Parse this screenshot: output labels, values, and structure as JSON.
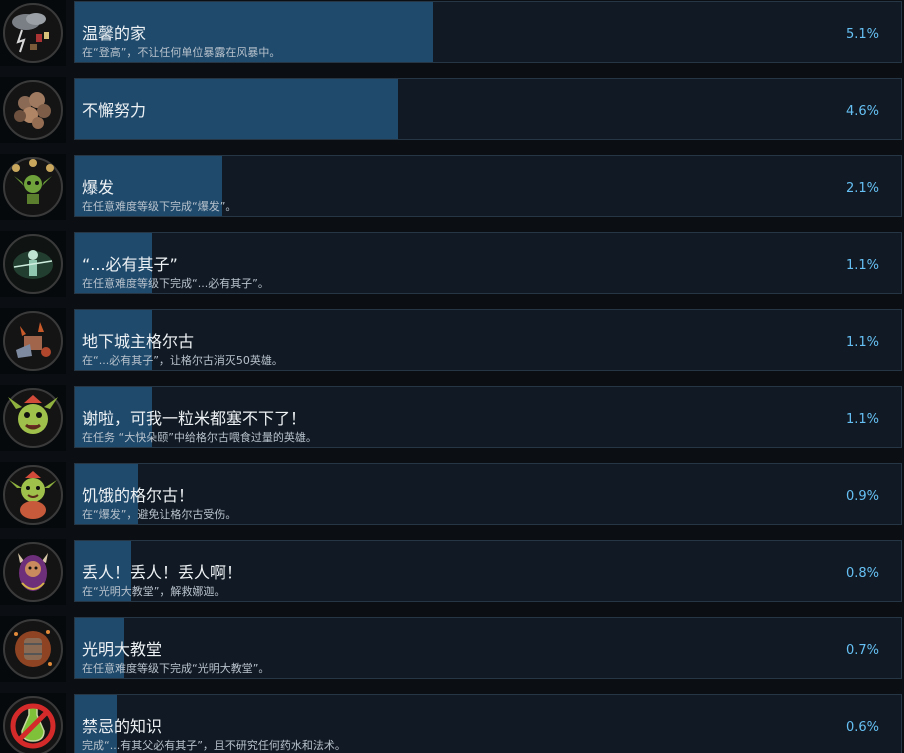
{
  "achievements": [
    {
      "title": "温馨的家",
      "desc": "在“登高”，不让任何单位暴露在风暴中。",
      "percent": "5.1%",
      "fraction": 0.051,
      "icon": "storm-cloud-icon"
    },
    {
      "title": "不懈努力",
      "desc": "",
      "percent": "4.6%",
      "fraction": 0.046,
      "icon": "rock-pile-icon"
    },
    {
      "title": "爆发",
      "desc": "在任意难度等级下完成“爆发”。",
      "percent": "2.1%",
      "fraction": 0.021,
      "icon": "goblin-juggler-icon"
    },
    {
      "title": "“...必有其子”",
      "desc": "在任意难度等级下完成“...必有其子”。",
      "percent": "1.1%",
      "fraction": 0.011,
      "icon": "ghost-figure-icon"
    },
    {
      "title": "地下城主格尔古",
      "desc": "在“...必有其子”，让格尔古消灭50英雄。",
      "percent": "1.1%",
      "fraction": 0.011,
      "icon": "dungeon-lord-icon"
    },
    {
      "title": "谢啦，可我一粒米都塞不下了！",
      "desc": "在任务 “大快朵颐”中给格尔古喂食过量的英雄。",
      "percent": "1.1%",
      "fraction": 0.011,
      "icon": "goblin-face-icon"
    },
    {
      "title": "饥饿的格尔古！",
      "desc": "在“爆发”，避免让格尔古受伤。",
      "percent": "0.9%",
      "fraction": 0.009,
      "icon": "hungry-goblin-icon"
    },
    {
      "title": "丢人！丢人！丢人啊！",
      "desc": "在“光明大教堂”，解救娜迦。",
      "percent": "0.8%",
      "fraction": 0.008,
      "icon": "naga-icon"
    },
    {
      "title": "光明大教堂",
      "desc": "在任意难度等级下完成“光明大教堂”。",
      "percent": "0.7%",
      "fraction": 0.007,
      "icon": "barrel-blast-icon"
    },
    {
      "title": "禁忌的知识",
      "desc": "完成“...有其父必有其子”，且不研究任何药水和法术。",
      "percent": "0.6%",
      "fraction": 0.006,
      "icon": "no-potion-icon"
    }
  ],
  "colors": {
    "bar": "#1f4a6c",
    "card": "#111a24",
    "percent": "#66c0f4"
  }
}
